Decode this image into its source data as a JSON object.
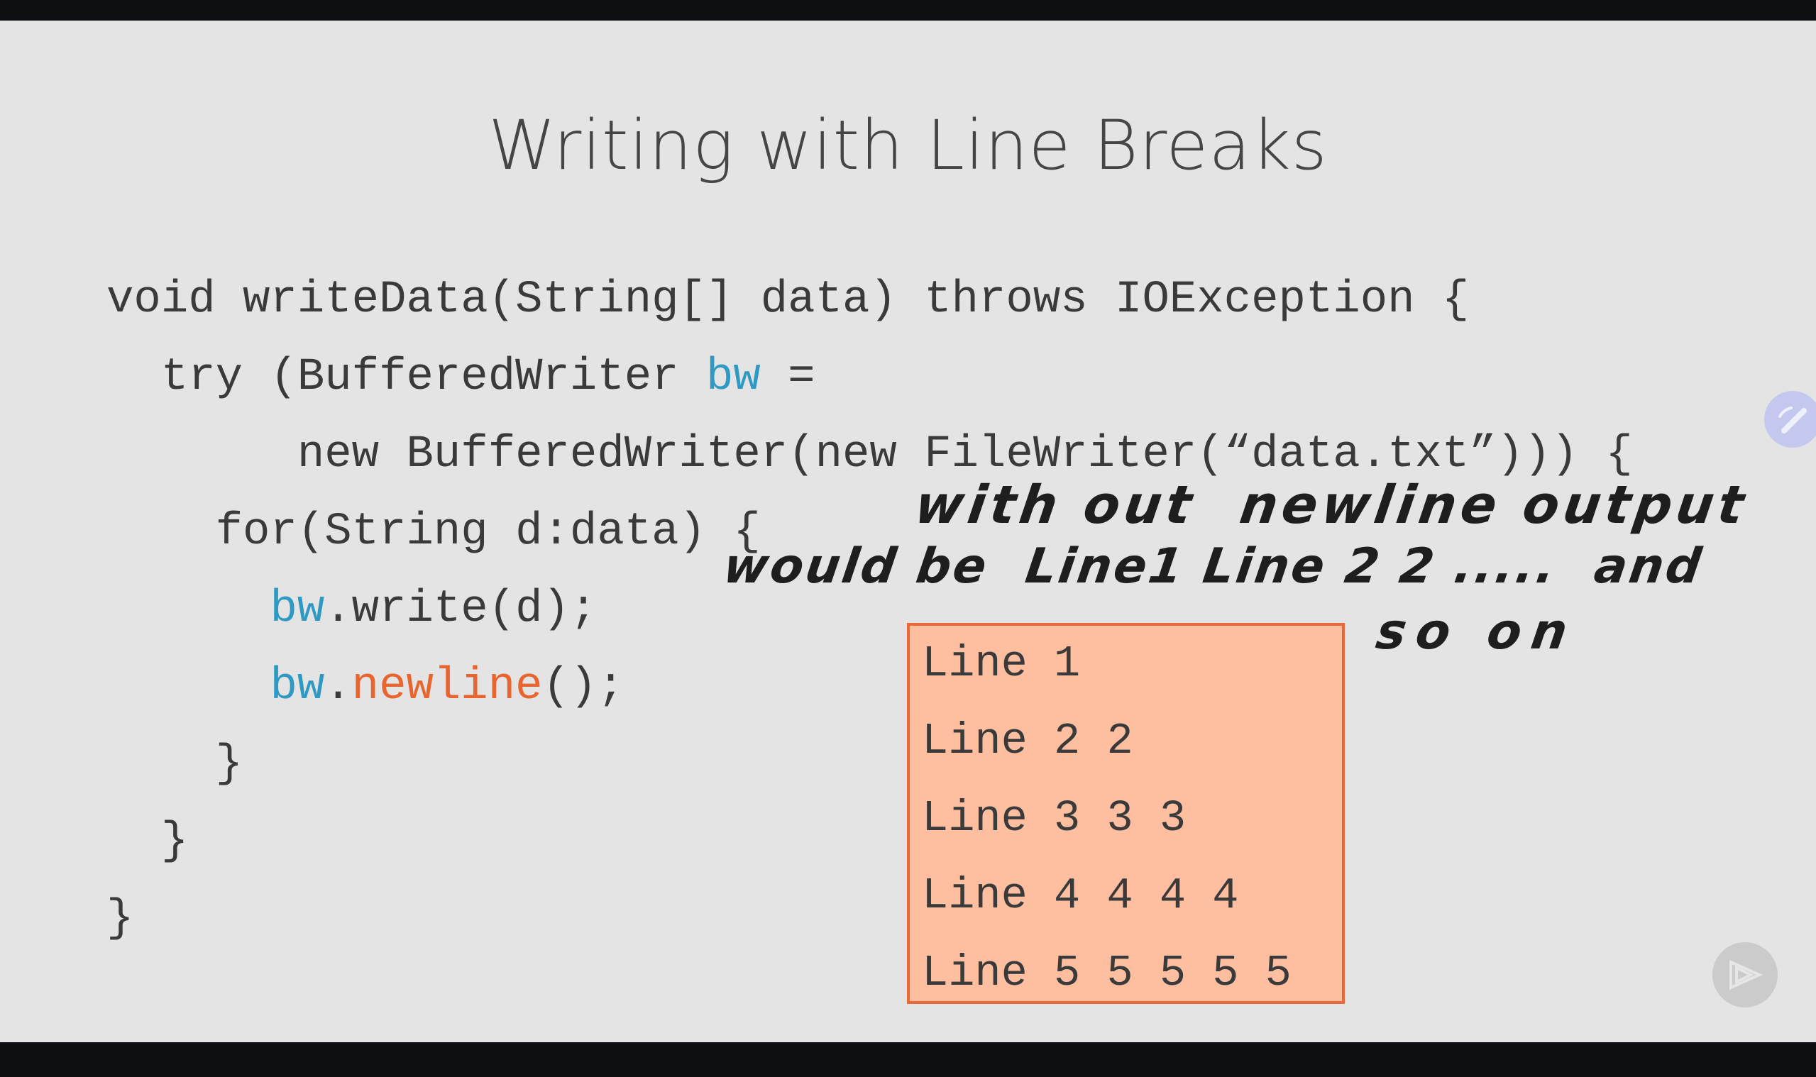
{
  "slide": {
    "title": "Writing with Line Breaks",
    "code": {
      "l1": "void writeData(String[] data) throws IOException {",
      "l2a": "  try (BufferedWriter ",
      "l2b": "bw",
      "l2c": " =",
      "l3": "       new BufferedWriter(new FileWriter(“data.txt”))) {",
      "l4": "    for(String d:data) {",
      "l5a": "      ",
      "l5b": "bw",
      "l5c": ".write(d);",
      "l6a": "      ",
      "l6b": "bw",
      "l6c": ".",
      "l6d": "newline",
      "l6e": "();",
      "l7": "    }",
      "l8": "  }",
      "l9": "}"
    },
    "output_lines": [
      "Line 1",
      "Line 2 2",
      "Line 3 3 3",
      "Line 4 4 4 4",
      "Line 5 5 5 5 5"
    ],
    "annotation": {
      "line1": "with out  newline output",
      "line2": "would be  Line1 Line 2 2 .....  and",
      "line3": "so on"
    },
    "colors": {
      "identifier": "#2e9ac4",
      "method": "#e8652f",
      "box_fill": "#fdbfa0",
      "box_border": "#e8693a"
    }
  },
  "controls": {
    "pen_icon": "pencil-icon",
    "play_icon": "play-icon"
  }
}
